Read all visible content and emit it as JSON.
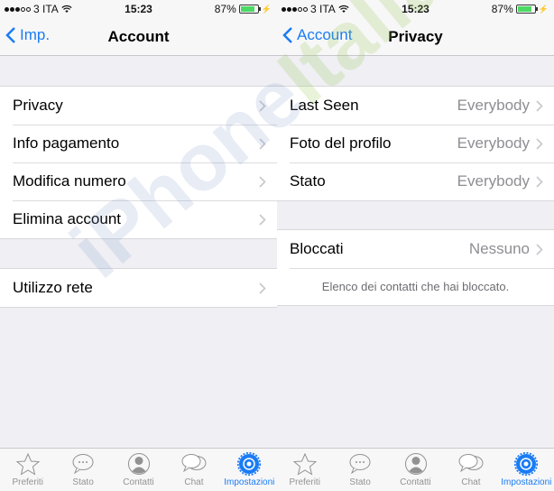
{
  "status_bar": {
    "carrier": "3 ITA",
    "signal_bars_filled": 3,
    "signal_bars_total": 5,
    "time": "15:23",
    "battery_percent_label": "87%",
    "battery_level": 0.87
  },
  "screens": [
    {
      "back_label": "Imp.",
      "title": "Account",
      "groups": [
        {
          "rows": [
            {
              "label": "Privacy"
            },
            {
              "label": "Info pagamento"
            },
            {
              "label": "Modifica numero"
            },
            {
              "label": "Elimina account"
            }
          ]
        },
        {
          "rows": [
            {
              "label": "Utilizzo rete"
            }
          ]
        }
      ]
    },
    {
      "back_label": "Account",
      "title": "Privacy",
      "groups": [
        {
          "rows": [
            {
              "label": "Last Seen",
              "value": "Everybody"
            },
            {
              "label": "Foto del profilo",
              "value": "Everybody"
            },
            {
              "label": "Stato",
              "value": "Everybody"
            }
          ]
        },
        {
          "rows": [
            {
              "label": "Bloccati",
              "value": "Nessuno"
            }
          ],
          "footer": "Elenco dei contatti che hai bloccato."
        }
      ]
    }
  ],
  "tabbar": {
    "items": [
      {
        "label": "Preferiti",
        "icon": "star-icon"
      },
      {
        "label": "Stato",
        "icon": "speech-bubble-icon"
      },
      {
        "label": "Contatti",
        "icon": "contact-icon"
      },
      {
        "label": "Chat",
        "icon": "chat-bubbles-icon"
      },
      {
        "label": "Impostazioni",
        "icon": "gear-icon",
        "active": true
      }
    ]
  },
  "watermark": {
    "text_a": "iPhone",
    "text_b": "Italia"
  },
  "colors": {
    "accent": "#1a7cf4",
    "battery": "#4cd964",
    "background": "#efeff4"
  }
}
